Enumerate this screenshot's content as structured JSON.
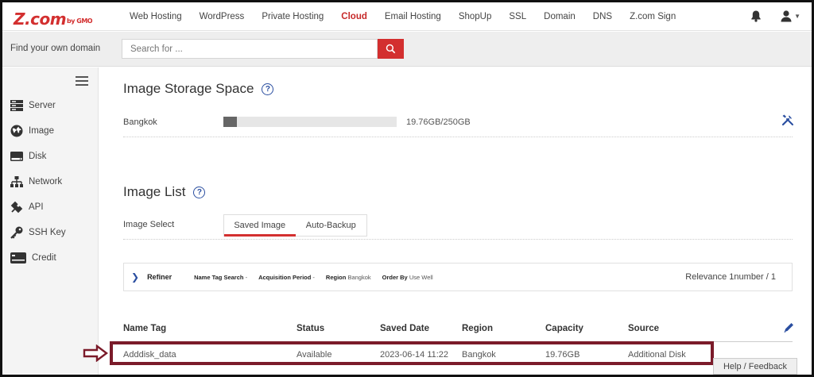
{
  "logo": {
    "main": "Z.com",
    "sub": "by GMO"
  },
  "nav": {
    "items": [
      "Web Hosting",
      "WordPress",
      "Private Hosting",
      "Cloud",
      "Email Hosting",
      "ShopUp",
      "SSL",
      "Domain",
      "DNS",
      "Z.com Sign"
    ],
    "active": "Cloud"
  },
  "search": {
    "label": "Find your own domain",
    "placeholder": "Search for ..."
  },
  "sidebar": {
    "items": [
      {
        "label": "Server",
        "icon": "server-icon"
      },
      {
        "label": "Image",
        "icon": "globe-icon"
      },
      {
        "label": "Disk",
        "icon": "disk-icon"
      },
      {
        "label": "Network",
        "icon": "network-icon"
      },
      {
        "label": "API",
        "icon": "api-icon"
      },
      {
        "label": "SSH Key",
        "icon": "key-icon"
      },
      {
        "label": "Credit",
        "icon": "credit-card-icon"
      }
    ]
  },
  "storage": {
    "title": "Image Storage Space",
    "region": "Bangkok",
    "used_fraction": 0.079,
    "value": "19.76GB/250GB"
  },
  "image_list": {
    "title": "Image List",
    "select_label": "Image Select",
    "tabs": [
      "Saved Image",
      "Auto-Backup"
    ],
    "active_tab": "Saved Image"
  },
  "refiner": {
    "label": "Refiner",
    "name_tag": "Name Tag Search",
    "name_tag_value": "-",
    "period": "Acquisition Period",
    "period_value": "-",
    "region": "Region",
    "region_value": "Bangkok",
    "order": "Order By",
    "order_value": "Use Well",
    "relevance": "Relevance 1number / 1"
  },
  "table": {
    "headers": [
      "Name Tag",
      "Status",
      "Saved Date",
      "Region",
      "Capacity",
      "Source"
    ],
    "rows": [
      [
        "Adddisk_data",
        "Available",
        "2023-06-14 11:22",
        "Bangkok",
        "19.76GB",
        "Additional Disk"
      ]
    ]
  },
  "help_feedback": "Help / Feedback",
  "colors": {
    "accent": "#d32f2f",
    "highlight": "#7b1b2a",
    "link": "#2a4ea0"
  }
}
